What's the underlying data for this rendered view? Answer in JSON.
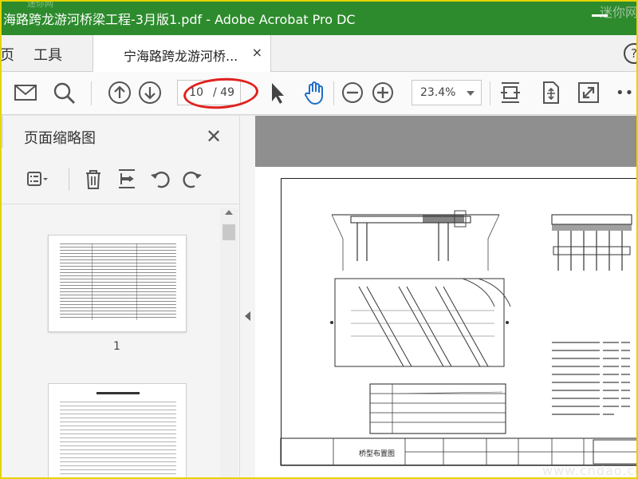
{
  "window": {
    "title": "海路跨龙游河桥梁工程-3月版1.pdf - Adobe Acrobat Pro DC",
    "brand_color": "#2d8b2d"
  },
  "tabs": {
    "home_label": "页",
    "tools_label": "工具",
    "doc_label": "宁海路跨龙游河桥...",
    "close_label": "×",
    "help_label": "?"
  },
  "toolbar": {
    "icons": [
      "mail-icon",
      "search-icon",
      "arrow-up-icon",
      "arrow-down-icon",
      "cursor-icon",
      "hand-icon",
      "zoom-out-icon",
      "zoom-in-icon",
      "fit-page-icon",
      "scroll-mode-icon",
      "fullscreen-icon",
      "more-icon"
    ],
    "page_current": "10",
    "page_total": "/ 49",
    "zoom": "23.4%",
    "more_label": "•••",
    "highlight_color": "#e0221e"
  },
  "thumbnails_panel": {
    "title": "页面缩略图",
    "close_label": "✕",
    "icons": [
      "options-icon",
      "delete-icon",
      "insert-page-icon",
      "rotate-left-icon",
      "rotate-right-icon"
    ],
    "pages": [
      {
        "number": "1"
      }
    ]
  },
  "document": {
    "drawing_title": "桥型布置图",
    "watermark": "www.cndao.com",
    "site_mark": "迷你网"
  }
}
